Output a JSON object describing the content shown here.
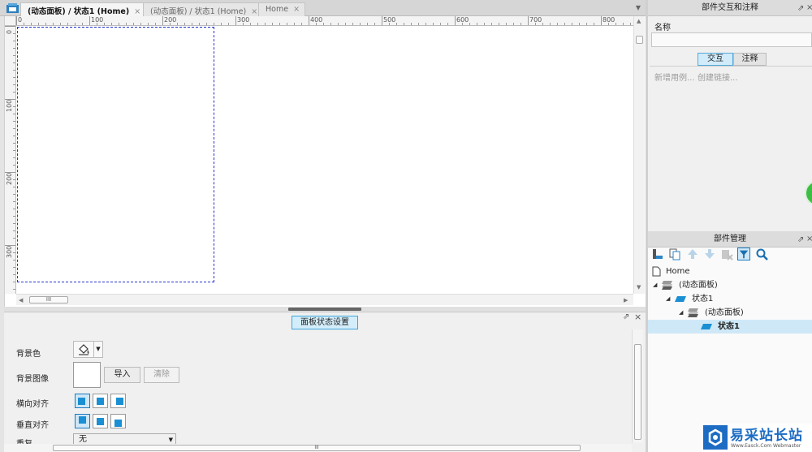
{
  "tabs": [
    {
      "label": "(动态面板) / 状态1 (Home)",
      "close": "×"
    },
    {
      "label": "(动态面板) / 状态1 (Home)",
      "close": "×"
    },
    {
      "label": "Home",
      "close": "×"
    }
  ],
  "ruler": {
    "top": [
      "0",
      "100",
      "200",
      "300",
      "400",
      "500",
      "600",
      "700",
      "800"
    ],
    "left": [
      "0",
      "100",
      "200",
      "300"
    ]
  },
  "scroll": {
    "grip": "III",
    "up": "▲",
    "down": "▼",
    "left": "◀",
    "right": "▶"
  },
  "bottom_panel": {
    "title": "面板状态设置",
    "pin": "⇗",
    "close": "×",
    "bg_color_label": "背景色",
    "bg_image_label": "背景图像",
    "import_btn": "导入",
    "clear_btn": "清除",
    "h_align_label": "横向对齐",
    "v_align_label": "垂直对齐",
    "repeat_label": "重复",
    "repeat_value": "无",
    "dd": "▼"
  },
  "interaction_panel": {
    "title": "部件交互和注释",
    "name_label": "名称",
    "tab_interactions": "交互",
    "tab_notes": "注释",
    "add_case": "新增用例...",
    "create_link": "创建链接...",
    "pin": "⇗",
    "close": "×"
  },
  "widget_panel": {
    "title": "部件管理",
    "pin": "⇗",
    "close": "×",
    "tree": [
      {
        "label": "Home",
        "level": 0
      },
      {
        "label": "(动态面板)",
        "level": 1
      },
      {
        "label": "状态1",
        "level": 2
      },
      {
        "label": "(动态面板)",
        "level": 3
      },
      {
        "label": "状态1",
        "level": 4,
        "selected": true
      }
    ]
  },
  "watermark": {
    "text": "易采站长站",
    "url": "Www.Easck.Com Webmaster"
  },
  "colors": {
    "accent": "#3ea6d8",
    "select": "#cfe8f7",
    "icon": "#1a8fd3",
    "guide": "#2233cc"
  }
}
